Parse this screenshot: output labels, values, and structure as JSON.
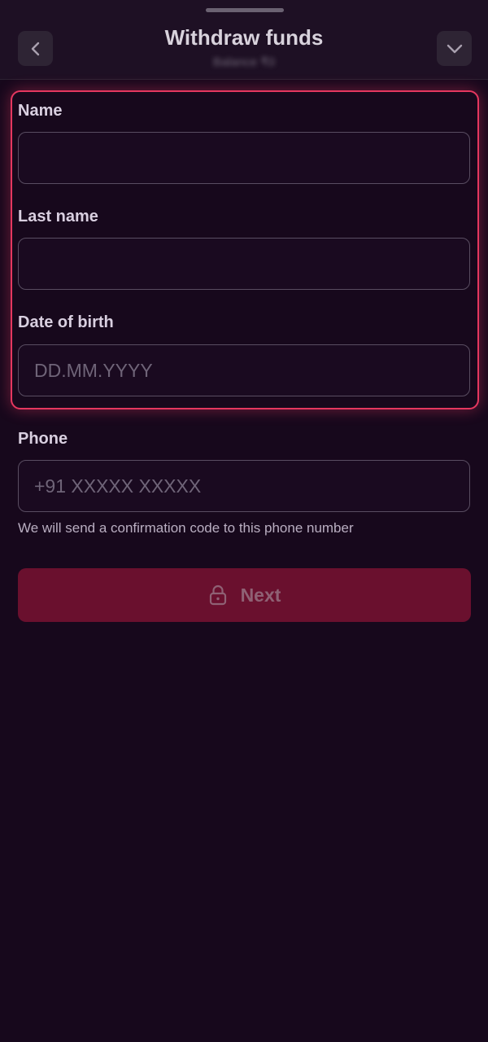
{
  "header": {
    "title": "Withdraw funds",
    "subtitle": "Balance ₹0",
    "back_icon": "chevron-left-icon",
    "collapse_icon": "chevron-down-icon"
  },
  "form": {
    "name": {
      "label": "Name",
      "value": "",
      "placeholder": ""
    },
    "last_name": {
      "label": "Last name",
      "value": "",
      "placeholder": ""
    },
    "date_of_birth": {
      "label": "Date of birth",
      "value": "",
      "placeholder": "DD.MM.YYYY"
    },
    "phone": {
      "label": "Phone",
      "value": "",
      "placeholder": "+91 XXXXX XXXXX",
      "hint": "We will send a confirmation code to this phone number"
    }
  },
  "next_button": {
    "label": "Next",
    "icon": "lock-icon",
    "state": "disabled"
  },
  "colors": {
    "background": "#17081c",
    "highlight_border": "#e5375f",
    "button_fill": "#6a102e"
  }
}
